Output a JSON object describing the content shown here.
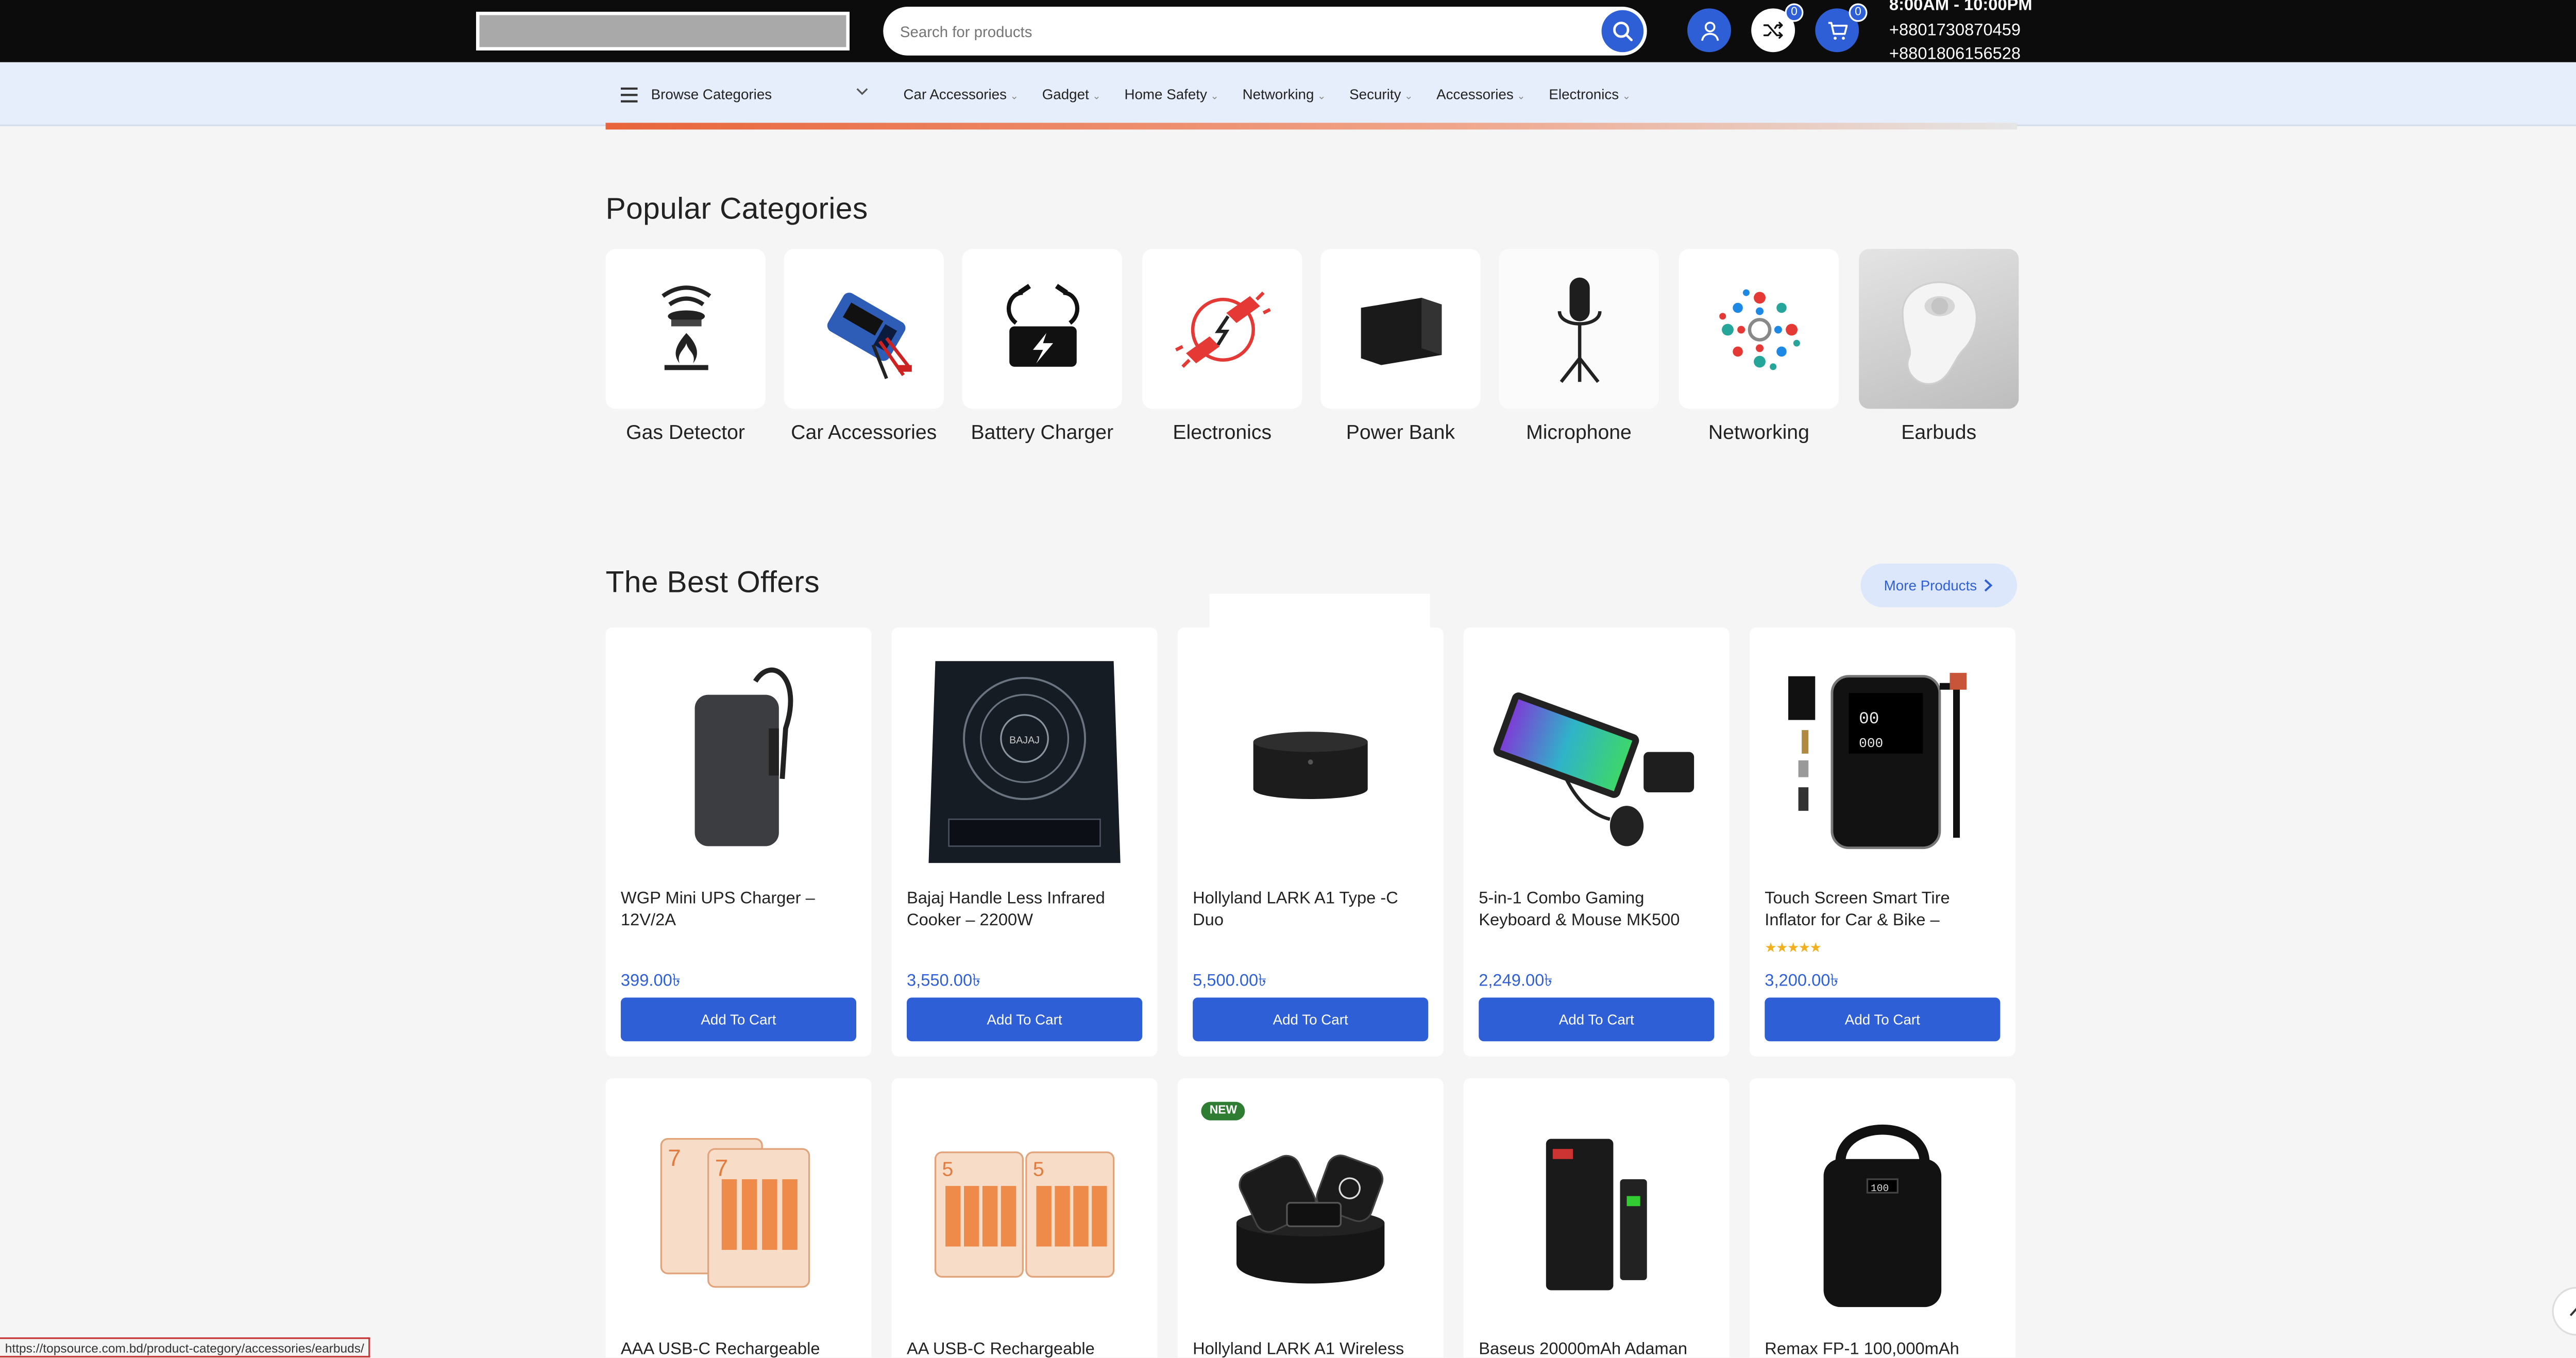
{
  "header": {
    "search_placeholder": "Search for products",
    "compare_count": "0",
    "cart_count": "0",
    "hours": "8:00AM - 10:00PM",
    "phone1": "+8801730870459",
    "phone2": "+8801806156528"
  },
  "nav": {
    "browse_label": "Browse Categories",
    "links": [
      "Car Accessories",
      "Gadget",
      "Home Safety",
      "Networking",
      "Security",
      "Accessories",
      "Electronics"
    ]
  },
  "popular": {
    "title": "Popular Categories",
    "items": [
      {
        "label": "Gas Detector"
      },
      {
        "label": "Car Accessories"
      },
      {
        "label": "Battery Charger"
      },
      {
        "label": "Electronics"
      },
      {
        "label": "Power Bank"
      },
      {
        "label": "Microphone"
      },
      {
        "label": "Networking"
      },
      {
        "label": "Earbuds"
      }
    ]
  },
  "offers": {
    "title": "The Best Offers",
    "more_label": "More Products",
    "cart_label": "Add To Cart",
    "new_label": "NEW",
    "products": [
      {
        "title": "WGP Mini UPS Charger – 12V/2A",
        "price": "399.00৳"
      },
      {
        "title": "Bajaj Handle Less Infrared Cooker – 2200W",
        "price": "3,550.00৳"
      },
      {
        "title": "Hollyland LARK A1 Type -C Duo",
        "price": "5,500.00৳"
      },
      {
        "title": "5-in-1 Combo Gaming Keyboard & Mouse MK500",
        "price": "2,249.00৳"
      },
      {
        "title": "Touch Screen Smart Tire Inflator for Car & Bike –",
        "price": "3,200.00৳",
        "rating": "★★★★★"
      },
      {
        "title": "AAA USB-C Rechargeable"
      },
      {
        "title": "AA USB-C Rechargeable"
      },
      {
        "title": "Hollyland LARK A1 Wireless"
      },
      {
        "title": "Baseus 20000mAh Adaman"
      },
      {
        "title": "Remax FP-1 100,000mAh"
      }
    ]
  },
  "status_url": "https://topsource.com.bd/product-category/accessories/earbuds/",
  "colors": {
    "accent": "#2f5fd6",
    "topbar": "#0c0c0c",
    "nav_bg": "#e6eefb"
  }
}
